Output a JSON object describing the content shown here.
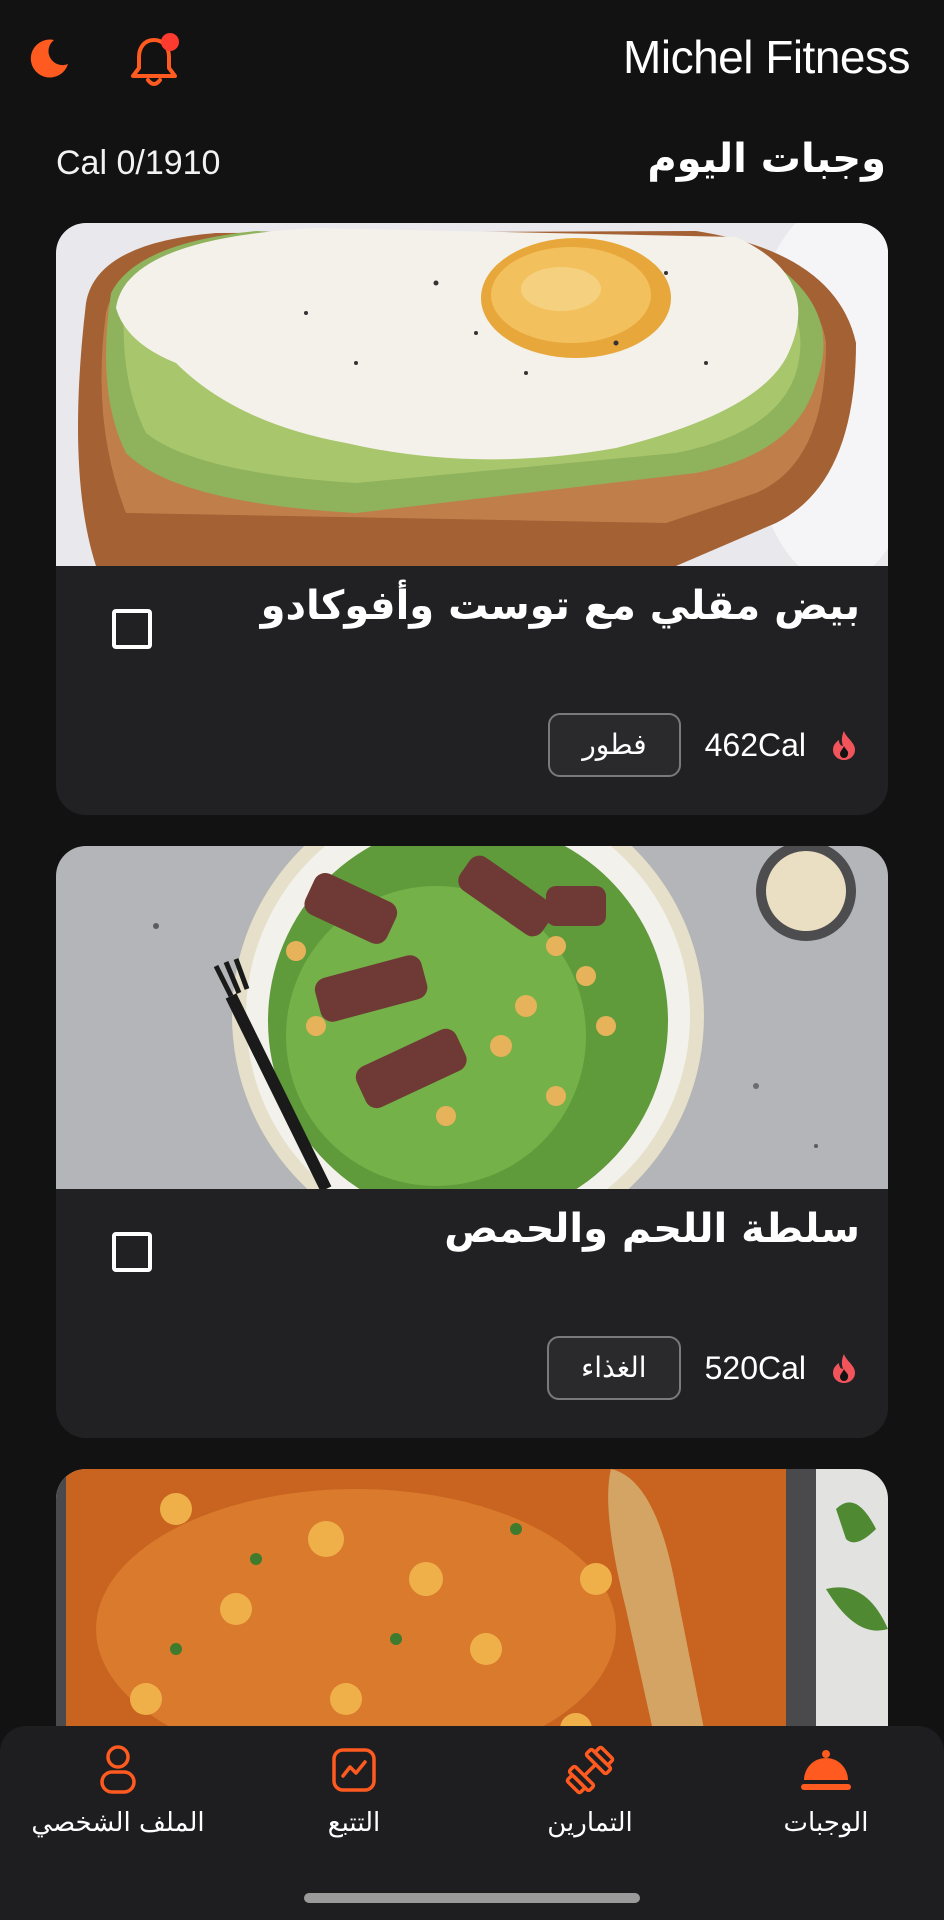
{
  "header": {
    "title": "Michel Fitness",
    "icons": [
      "moon-icon",
      "bell-icon"
    ],
    "notification_dot": true
  },
  "meals_section": {
    "title": "وجبات اليوم",
    "calories": "Cal 0/1910"
  },
  "meals": [
    {
      "name": "بيض مقلي مع توست وأفوكادو",
      "calories": "462Cal",
      "tag": "فطور",
      "checked": false,
      "image": "fried-egg-avocado-toast"
    },
    {
      "name": "سلطة اللحم والحمص",
      "calories": "520Cal",
      "tag": "الغذاء",
      "checked": false,
      "image": "steak-chickpea-salad"
    },
    {
      "name": "",
      "image": "chickpea-curry-pot"
    }
  ],
  "bottom_nav": [
    {
      "label": "الملف الشخصي",
      "icon": "profile-icon",
      "active": false
    },
    {
      "label": "التتبع",
      "icon": "tracking-icon",
      "active": false
    },
    {
      "label": "التمارين",
      "icon": "dumbbell-icon",
      "active": false
    },
    {
      "label": "الوجبات",
      "icon": "cloche-icon",
      "active": true
    }
  ],
  "colors": {
    "accent": "#FF5A1F",
    "background": "#121212",
    "card": "#212123",
    "flame": "#F2545B"
  }
}
